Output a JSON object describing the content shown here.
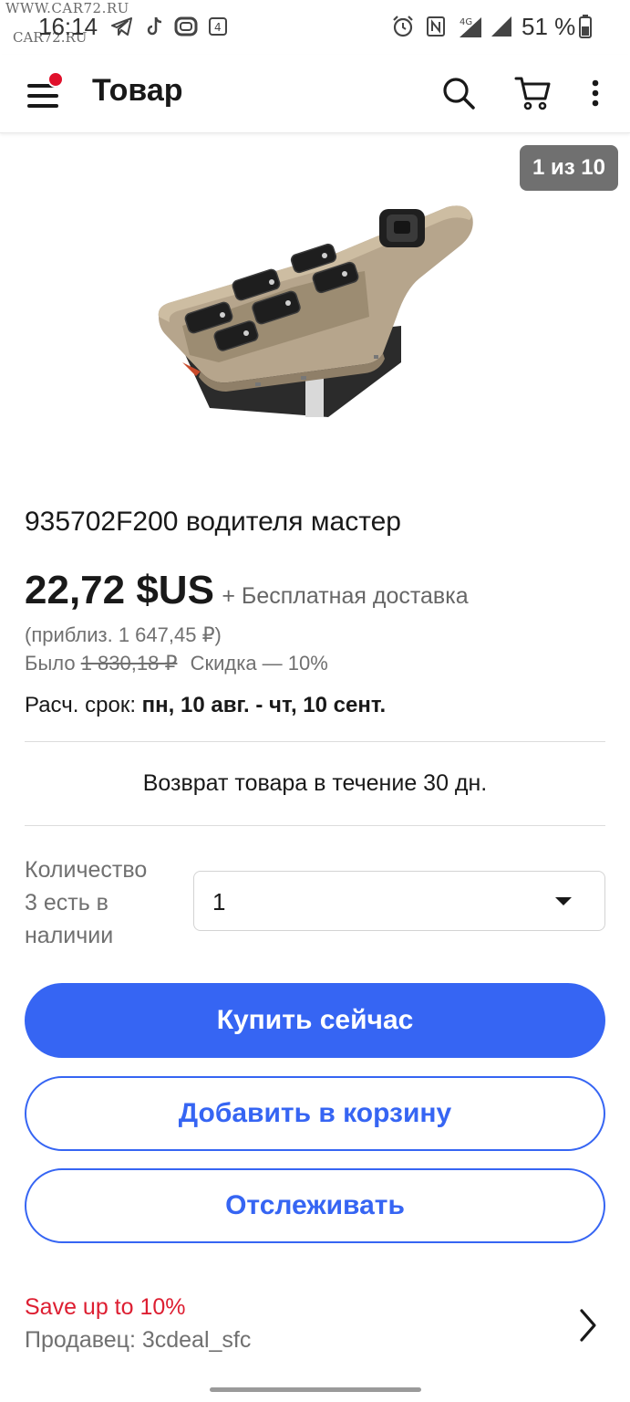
{
  "status_bar": {
    "watermark_top": "WWW.CAR72.RU",
    "watermark_bottom": "CAR72.RU",
    "time": "16:14",
    "battery_percent": "51 %",
    "icons": [
      "telegram-icon",
      "tiktok-icon",
      "app-icon",
      "notification-icon",
      "alarm-icon",
      "nfc-icon",
      "signal-4g-icon",
      "signal-icon",
      "battery-icon"
    ]
  },
  "app_bar": {
    "title": "Товар",
    "icons": [
      "menu-icon",
      "search-icon",
      "cart-icon",
      "more-icon"
    ]
  },
  "gallery": {
    "counter": "1 из 10"
  },
  "product": {
    "title": "935702F200 водителя мастер",
    "price": "22,72 $US",
    "shipping": "+ Бесплатная доставка",
    "approx_price": "(приблиз. 1 647,45 ₽)",
    "was_label": "Было",
    "was_price": "1 830,18 ₽",
    "discount": "Скидка — 10%",
    "delivery_label": "Расч. срок:",
    "delivery_dates": "пн, 10 авг. - чт, 10 сент.",
    "returns": "Возврат товара в течение 30 дн."
  },
  "quantity": {
    "label_line1": "Количество",
    "label_line2": "3 есть в",
    "label_line3": "наличии",
    "selected": "1"
  },
  "actions": {
    "buy_now": "Купить сейчас",
    "add_to_cart": "Добавить в корзину",
    "watch": "Отслеживать"
  },
  "seller": {
    "promo": "Save up to 10%",
    "name": "Продавец: 3cdeal_sfc"
  },
  "colors": {
    "primary": "#3665f3",
    "promo_red": "#dd1e31",
    "badge_red": "#e0102b"
  }
}
